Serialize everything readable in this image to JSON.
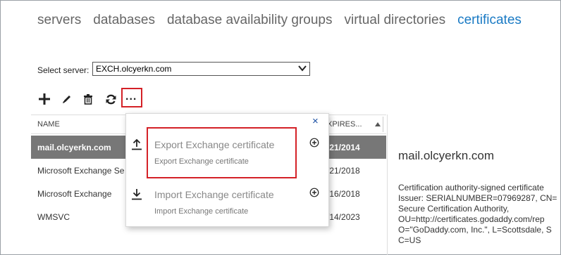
{
  "nav": {
    "tabs": [
      "servers",
      "databases",
      "database availability groups",
      "virtual directories",
      "certificates"
    ],
    "active_index": 4
  },
  "server_select": {
    "label": "Select server:",
    "value": "EXCH.olcyerkn.com"
  },
  "toolbar": {
    "icons": [
      "add-icon",
      "edit-icon",
      "delete-icon",
      "refresh-icon",
      "more-icon"
    ],
    "more_label": "..."
  },
  "table": {
    "headers": {
      "name": "NAME",
      "expires": "XPIRES..."
    },
    "rows": [
      {
        "name": "mail.olcyerkn.com",
        "expires": "/21/2014",
        "selected": true
      },
      {
        "name": "Microsoft Exchange Se",
        "expires": "/21/2018",
        "selected": false
      },
      {
        "name": "Microsoft Exchange",
        "expires": "/16/2018",
        "selected": false
      },
      {
        "name": "WMSVC",
        "expires": "/14/2023",
        "selected": false
      }
    ]
  },
  "details": {
    "title": "mail.olcyerkn.com",
    "lines": [
      "Certification authority-signed certificate",
      "Issuer: SERIALNUMBER=07969287, CN=",
      "Secure Certification Authority,",
      "OU=http://certificates.godaddy.com/rep",
      "O=\"GoDaddy.com, Inc.\", L=Scottsdale, S",
      "C=US"
    ]
  },
  "popup": {
    "close_label": "×",
    "items": [
      {
        "title": "Export Exchange certificate",
        "description": "Export Exchange certificate",
        "icon": "upload-icon"
      },
      {
        "title": "Import Exchange certificate",
        "description": "Import Exchange certificate",
        "icon": "download-icon"
      }
    ]
  },
  "colors": {
    "accent": "#1a7ac4",
    "highlight": "#d42127",
    "selected_row": "#777777"
  }
}
